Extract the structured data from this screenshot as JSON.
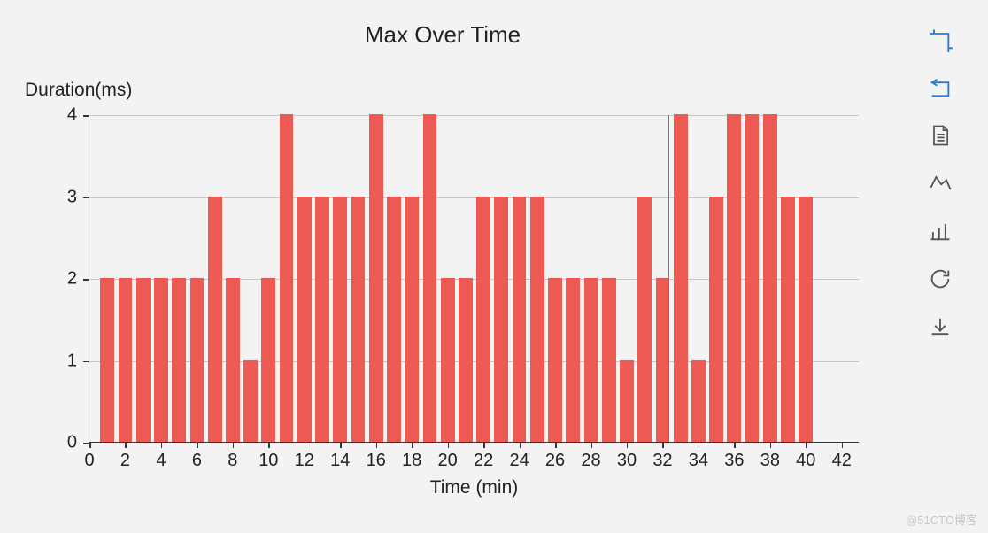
{
  "chart_data": {
    "type": "bar",
    "title": "Max Over Time",
    "xlabel": "Time (min)",
    "ylabel": "Duration(ms)",
    "xlim": [
      0,
      43
    ],
    "ylim": [
      0,
      4
    ],
    "x_ticks": [
      0,
      2,
      4,
      6,
      8,
      10,
      12,
      14,
      16,
      18,
      20,
      22,
      24,
      26,
      28,
      30,
      32,
      34,
      36,
      38,
      40,
      42
    ],
    "y_ticks": [
      0,
      1,
      2,
      3,
      4
    ],
    "x": [
      1,
      2,
      3,
      4,
      5,
      6,
      7,
      8,
      9,
      10,
      11,
      12,
      13,
      14,
      15,
      16,
      17,
      18,
      19,
      20,
      21,
      22,
      23,
      24,
      25,
      26,
      27,
      28,
      29,
      30,
      31,
      32,
      33,
      34,
      35,
      36,
      37,
      38,
      39,
      40
    ],
    "values": [
      2,
      2,
      2,
      2,
      2,
      2,
      3,
      2,
      1,
      2,
      4,
      3,
      3,
      3,
      3,
      4,
      3,
      3,
      4,
      2,
      2,
      3,
      3,
      3,
      3,
      2,
      2,
      2,
      2,
      1,
      3,
      2,
      4,
      1,
      3,
      4,
      4,
      4,
      3,
      3
    ],
    "cursor_x": 32.3,
    "bar_color": "#ec5a53"
  },
  "toolbar": {
    "crop_label": "crop",
    "undo_label": "undo",
    "document_label": "document",
    "line_label": "line-chart",
    "bar_label": "bar-chart",
    "refresh_label": "refresh",
    "download_label": "download"
  },
  "watermark": "@51CTO博客"
}
